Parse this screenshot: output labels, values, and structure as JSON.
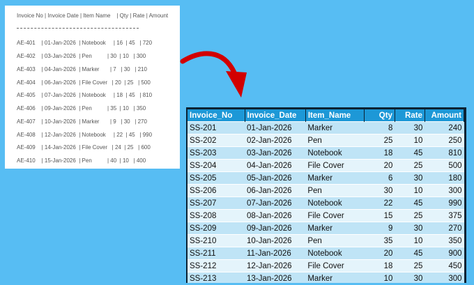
{
  "raw_text": {
    "header": "Invoice No | Invoice Date | Item Name    | Qty | Rate | Amount",
    "separator": "----------------------------------------------------------------",
    "lines": [
      "AE-401    | 01-Jan-2026  | Notebook     | 16  | 45   | 720",
      "AE-402    | 03-Jan-2026  | Pen          | 30  | 10   | 300",
      "AE-403    | 04-Jan-2026  | Marker       | 7   | 30   | 210",
      "AE-404    | 06-Jan-2026  | File Cover   | 20  | 25   | 500",
      "AE-405    | 07-Jan-2026  | Notebook     | 18  | 45   | 810",
      "AE-406    | 09-Jan-2026  | Pen          | 35  | 10   | 350",
      "AE-407    | 10-Jan-2026  | Marker       | 9   | 30   | 270",
      "AE-408    | 12-Jan-2026  | Notebook     | 22  | 45   | 990",
      "AE-409    | 14-Jan-2026  | File Cover   | 24  | 25   | 600",
      "AE-410    | 15-Jan-2026  | Pen          | 40  | 10   | 400"
    ]
  },
  "table": {
    "headers": [
      "Invoice_No",
      "Invoice_Date",
      "Item_Name",
      "Qty",
      "Rate",
      "Amount"
    ],
    "rows": [
      [
        "SS-201",
        "01-Jan-2026",
        "Marker",
        "8",
        "30",
        "240"
      ],
      [
        "SS-202",
        "02-Jan-2026",
        "Pen",
        "25",
        "10",
        "250"
      ],
      [
        "SS-203",
        "03-Jan-2026",
        "Notebook",
        "18",
        "45",
        "810"
      ],
      [
        "SS-204",
        "04-Jan-2026",
        "File Cover",
        "20",
        "25",
        "500"
      ],
      [
        "SS-205",
        "05-Jan-2026",
        "Marker",
        "6",
        "30",
        "180"
      ],
      [
        "SS-206",
        "06-Jan-2026",
        "Pen",
        "30",
        "10",
        "300"
      ],
      [
        "SS-207",
        "07-Jan-2026",
        "Notebook",
        "22",
        "45",
        "990"
      ],
      [
        "SS-208",
        "08-Jan-2026",
        "File Cover",
        "15",
        "25",
        "375"
      ],
      [
        "SS-209",
        "09-Jan-2026",
        "Marker",
        "9",
        "30",
        "270"
      ],
      [
        "SS-210",
        "10-Jan-2026",
        "Pen",
        "35",
        "10",
        "350"
      ],
      [
        "SS-211",
        "11-Jan-2026",
        "Notebook",
        "20",
        "45",
        "900"
      ],
      [
        "SS-212",
        "12-Jan-2026",
        "File Cover",
        "18",
        "25",
        "450"
      ],
      [
        "SS-213",
        "13-Jan-2026",
        "Marker",
        "10",
        "30",
        "300"
      ]
    ]
  },
  "colors": {
    "background": "#57bdf3",
    "header": "#1d98d7",
    "row_odd": "#bfe4f6",
    "row_even": "#e4f4fb",
    "arrow": "#d20000"
  },
  "icons": {
    "arrow": "curved-arrow-icon"
  }
}
